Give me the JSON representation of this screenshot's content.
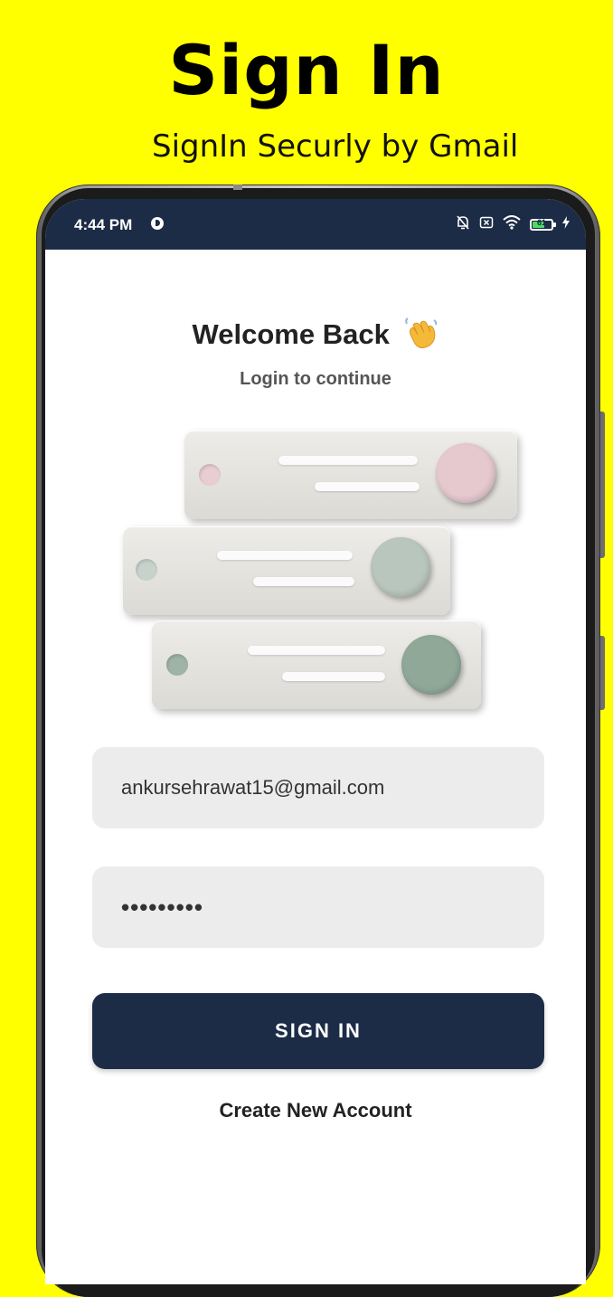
{
  "promo": {
    "title": "Sign In",
    "subtitle": "SignIn Securly by Gmail"
  },
  "status_bar": {
    "time": "4:44 PM",
    "battery_level": "61",
    "icons": [
      "app-notification-icon",
      "mute-bell-icon",
      "no-sim-icon",
      "wifi-icon",
      "battery-icon",
      "charging-bolt-icon"
    ]
  },
  "login": {
    "title": "Welcome Back",
    "title_emoji": "waving-hand-icon",
    "subtitle": "Login to continue",
    "email_value": "ankursehrawat15@gmail.com",
    "password_value": "•••••••••",
    "signin_label": "SIGN IN",
    "create_account_label": "Create New Account"
  },
  "colors": {
    "background": "#FFFF00",
    "primary": "#1c2c47",
    "input_bg": "#ececec",
    "illustration_pink": "#e8cdd3",
    "illustration_sage": "#b9c6bd",
    "illustration_green": "#8fa898"
  }
}
